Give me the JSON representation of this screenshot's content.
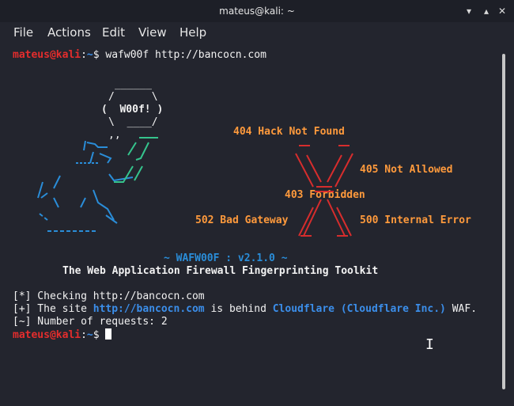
{
  "window": {
    "title": "mateus@kali: ~",
    "controls": {
      "minimize": "▾",
      "maximize": "▴",
      "close": "✕"
    }
  },
  "menu": [
    "File",
    "Actions",
    "Edit",
    "View",
    "Help"
  ],
  "terminal": {
    "prompt_user": "mateus@kali",
    "prompt_sep": ":",
    "prompt_path": "~",
    "prompt_symbol": "$",
    "command": " wafw00f http://bancocn.com",
    "ascii_speech": [
      "______",
      "/      \\",
      "(  W00f! )",
      "\\  ____/",
      ",,"
    ],
    "dog_lines": [
      "|`-.__",
      "/ ' _/",
      "****`",
      "/    }",
      "/  \\ /",
      "\\ /`   \\\\\\",
      "`\\    /_\\\\",
      "`~~~~~``~`"
    ],
    "errors": {
      "e404": "404 Hack Not Found",
      "e405": "405 Not Allowed",
      "e403": "403 Forbidden",
      "e502": "502 Bad Gateway",
      "e500": "500 Internal Error"
    },
    "version": "~ WAFW00F : v2.1.0 ~",
    "subtitle": "The Web Application Firewall Fingerprinting Toolkit",
    "output": {
      "line1_prefix": "[*] Checking http://bancocn.com",
      "line2_prefix": "[+] The site ",
      "line2_url": "http://bancocn.com",
      "line2_mid": " is behind ",
      "line2_waf": "Cloudflare (Cloudflare Inc.)",
      "line2_suffix": " WAF.",
      "line3": "[~] Number of requests: 2"
    }
  },
  "colors": {
    "background": "#23252e",
    "prompt_user": "#e42d2d",
    "prompt_path": "#3b8eea",
    "error_text": "#ff9a3c",
    "x_mark": "#d62d2d"
  }
}
